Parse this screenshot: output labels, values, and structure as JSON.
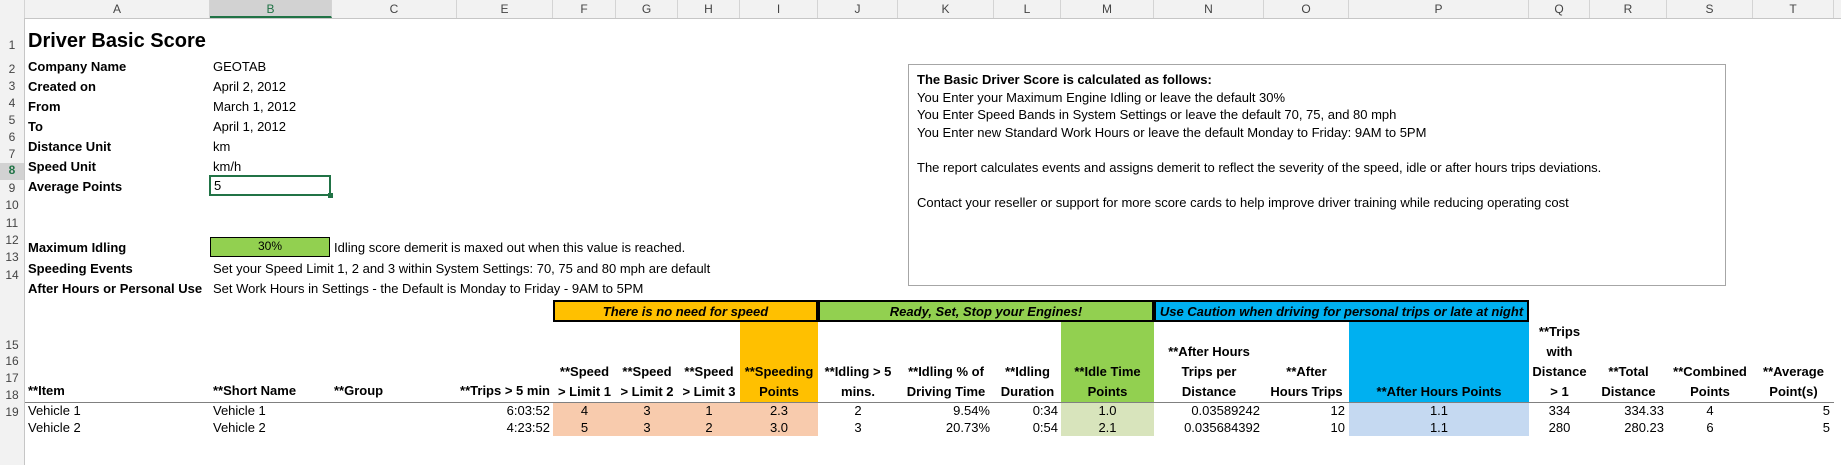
{
  "columns": [
    "A",
    "B",
    "C",
    "E",
    "F",
    "G",
    "H",
    "I",
    "J",
    "K",
    "L",
    "M",
    "N",
    "O",
    "P",
    "Q",
    "R",
    "S",
    "T"
  ],
  "rows": [
    "1",
    "2",
    "3",
    "4",
    "5",
    "6",
    "7",
    "8",
    "9",
    "10",
    "11",
    "12",
    "13",
    "14",
    "15",
    "16",
    "17",
    "18",
    "19"
  ],
  "title": "Driver Basic Score",
  "meta": [
    {
      "label": "Company Name",
      "value": "GEOTAB"
    },
    {
      "label": "Created on",
      "value": "April 2, 2012"
    },
    {
      "label": "From",
      "value": "March 1, 2012"
    },
    {
      "label": "To",
      "value": "April 1, 2012"
    },
    {
      "label": "Distance Unit",
      "value": "km"
    },
    {
      "label": "Speed Unit",
      "value": "km/h"
    },
    {
      "label": "Average Points",
      "value": "5"
    }
  ],
  "settings": [
    {
      "label": "Maximum Idling",
      "value": "30%",
      "note": "Idling score demerit is maxed out when this value is reached."
    },
    {
      "label": "Speeding Events",
      "note": "Set your Speed Limit 1, 2 and 3 within System Settings: 70, 75 and 80 mph are default"
    },
    {
      "label": "After Hours or Personal Use",
      "note": "Set Work Hours in Settings - the Default is Monday to Friday - 9AM to 5PM"
    }
  ],
  "info": {
    "heading": "The Basic Driver Score is calculated as follows:",
    "lines": [
      "You Enter your Maximum Engine Idling or leave the default  30%",
      "You Enter Speed Bands in System Settings or leave the default 70, 75, and 80 mph",
      "You Enter new Standard Work Hours or leave the default Monday to Friday: 9AM to 5PM",
      "",
      "The report calculates events and assigns demerit to reflect the severity of the speed, idle or after hours trips deviations.",
      "",
      "Contact your reseller or support for more score cards to help improve driver training while reducing operating cost"
    ]
  },
  "banners": {
    "speed": "There is no need for speed",
    "idle": "Ready, Set, Stop your Engines!",
    "after": "Use Caution when driving for personal trips or late at night"
  },
  "colors": {
    "speed_banner": "#ffc000",
    "idle_banner": "#92d050",
    "after_banner": "#00b0f0",
    "speed_cells": "#f8cbad",
    "idle_cells": "#d8e4bc",
    "after_cells": "#c5d9f1",
    "selection": "#217346"
  },
  "headers": {
    "item": "**Item",
    "short": "**Short Name",
    "group": "**Group",
    "trips5": "**Trips > 5 min",
    "spd1": [
      "**Speed",
      "> Limit 1"
    ],
    "spd2": [
      "**Speed",
      "> Limit 2"
    ],
    "spd3": [
      "**Speed",
      "> Limit 3"
    ],
    "spdpts": [
      "**Speeding",
      "Points"
    ],
    "idle5": [
      "**Idling > 5",
      "mins."
    ],
    "idlepct": [
      "**Idling % of",
      "Driving Time"
    ],
    "idledur": [
      "**Idling",
      "Duration"
    ],
    "idlepts": [
      "**Idle Time",
      "Points"
    ],
    "ahdist": [
      "**After Hours",
      "Trips per",
      "Distance"
    ],
    "ahtrips": [
      "**After",
      "Hours Trips"
    ],
    "ahpts": "**After Hours Points",
    "tripsdist": [
      "**Trips",
      "with",
      "Distance",
      "> 1"
    ],
    "totdist": [
      "**Total",
      "Distance"
    ],
    "combined": [
      "**Combined",
      "Points"
    ],
    "avgpts": [
      "**Average",
      "Point(s)"
    ]
  },
  "vehicles": [
    {
      "item": "Vehicle 1",
      "short": "Vehicle 1",
      "trips5": "6:03:52",
      "spd1": "4",
      "spd2": "3",
      "spd3": "1",
      "spdpts": "2.3",
      "idle5": "2",
      "idlepct": "9.54%",
      "idledur": "0:34",
      "idlepts": "1.0",
      "ahdist": "0.03589242",
      "ahtrips": "12",
      "ahpts": "1.1",
      "tripsdist": "334",
      "totdist": "334.33",
      "combined": "4",
      "avgpts": "5"
    },
    {
      "item": "Vehicle 2",
      "short": "Vehicle 2",
      "trips5": "4:23:52",
      "spd1": "5",
      "spd2": "3",
      "spd3": "2",
      "spdpts": "3.0",
      "idle5": "3",
      "idlepct": "20.73%",
      "idledur": "0:54",
      "idlepts": "2.1",
      "ahdist": "0.035684392",
      "ahtrips": "10",
      "ahpts": "1.1",
      "tripsdist": "280",
      "totdist": "280.23",
      "combined": "6",
      "avgpts": "5"
    }
  ]
}
